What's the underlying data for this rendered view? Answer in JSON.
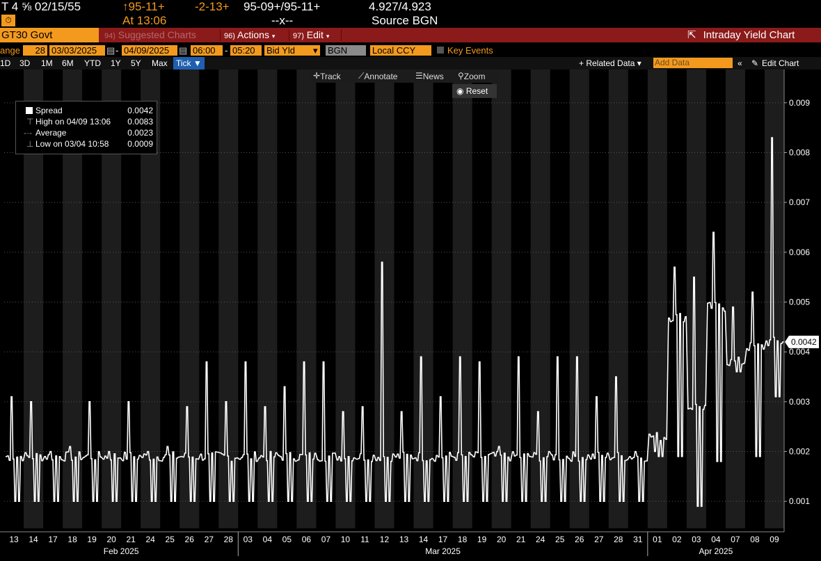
{
  "header": {
    "security": "T 4 ⅝ 02/15/55",
    "price": "↑95-11+",
    "change": "-2-13+",
    "bid_ask": "95-09+/95-11+",
    "yields": "4.927/4.923",
    "time": "At 13:06",
    "size": "--x--",
    "source": "Source BGN"
  },
  "toolbar": {
    "ticker": "GT30 Govt",
    "suggested": "Suggested Charts",
    "suggested_num": "94)",
    "actions": "Actions",
    "actions_num": "96)",
    "edit": "Edit",
    "edit_num": "97)",
    "title": "Intraday Yield Chart"
  },
  "settings": {
    "range_label": "ange",
    "period": "28",
    "start_date": "03/03/2025",
    "end_date": "04/09/2025",
    "start_time": "06:00",
    "end_time": "05:20",
    "field": "Bid Yld",
    "source": "BGN",
    "currency": "Local CCY",
    "key_events": "Key Events"
  },
  "ranges": [
    "1D",
    "3D",
    "1M",
    "6M",
    "YTD",
    "1Y",
    "5Y",
    "Max"
  ],
  "tick_label": "Tick ▼",
  "related_data": "+ Related Data ▾",
  "add_data_placeholder": "Add Data",
  "edit_chart": "Edit Chart",
  "chart_tools": {
    "track": "Track",
    "annotate": "Annotate",
    "news": "News",
    "zoom": "Zoom",
    "reset": "Reset"
  },
  "legend": {
    "series": "Spread",
    "series_value": "0.0042",
    "high_label": "High on 04/09 13:06",
    "high_value": "0.0083",
    "avg_label": "Average",
    "avg_value": "0.0023",
    "low_label": "Low on 03/04 10:58",
    "low_value": "0.0009"
  },
  "chart_data": {
    "type": "line",
    "y_ticks": [
      "0.009",
      "0.008",
      "0.007",
      "0.006",
      "0.005",
      "0.004",
      "0.003",
      "0.002",
      "0.001"
    ],
    "ylim": [
      0.0005,
      0.0095
    ],
    "last_value": "0.0042",
    "x_days": [
      "13",
      "14",
      "17",
      "18",
      "19",
      "20",
      "21",
      "24",
      "25",
      "26",
      "27",
      "28",
      "03",
      "04",
      "05",
      "06",
      "07",
      "10",
      "11",
      "12",
      "13",
      "14",
      "17",
      "18",
      "19",
      "20",
      "21",
      "24",
      "25",
      "26",
      "27",
      "28",
      "31",
      "01",
      "02",
      "03",
      "04",
      "07",
      "08",
      "09"
    ],
    "months": [
      "Feb 2025",
      "Mar 2025",
      "Apr 2025"
    ],
    "series": [
      {
        "name": "Spread",
        "values": [
          0.005,
          0.0028,
          0.0018,
          0.0012,
          0.0029,
          0.0029,
          0.0019,
          0.0017,
          0.0024,
          0.0018,
          0.0016,
          0.0025,
          0.0022,
          0.0021,
          0.0029,
          0.0028,
          0.0038,
          0.0025,
          0.0022,
          0.0055,
          0.0023,
          0.0025,
          0.0034,
          0.0031,
          0.003,
          0.0021,
          0.0031,
          0.0025,
          0.0036,
          0.0027,
          0.0033,
          0.0035,
          0.0025,
          0.0023,
          0.0047,
          0.0029,
          0.0049,
          0.0038,
          0.0041,
          0.0042
        ]
      }
    ],
    "peaks": [
      0.0031,
      0.003,
      0.002,
      0.0021,
      0.003,
      0.002,
      0.003,
      0.002,
      0.0021,
      0.0029,
      0.0038,
      0.003,
      0.0038,
      0.0029,
      0.0033,
      0.0038,
      0.0038,
      0.0028,
      0.0029,
      0.0058,
      0.0028,
      0.0039,
      0.0031,
      0.0039,
      0.0038,
      0.0021,
      0.0039,
      0.0028,
      0.0039,
      0.0039,
      0.0031,
      0.0035,
      0.002,
      0.002,
      0.0057,
      0.0055,
      0.0064,
      0.0049,
      0.0052,
      0.0083
    ],
    "troughs": [
      0.001,
      0.001,
      0.001,
      0.001,
      0.001,
      0.001,
      0.001,
      0.001,
      0.001,
      0.001,
      0.001,
      0.001,
      0.001,
      0.001,
      0.001,
      0.001,
      0.001,
      0.001,
      0.001,
      0.001,
      0.001,
      0.001,
      0.001,
      0.001,
      0.001,
      0.001,
      0.001,
      0.001,
      0.001,
      0.001,
      0.001,
      0.001,
      0.001,
      0.0019,
      0.0019,
      0.0009,
      0.0018,
      0.0036,
      0.0019,
      0.0031
    ]
  },
  "colors": {
    "orange": "#f39a1e",
    "red_bar": "#8b1a1a",
    "tick_blue": "#1f5fb0",
    "band": "#1d1d1d"
  }
}
